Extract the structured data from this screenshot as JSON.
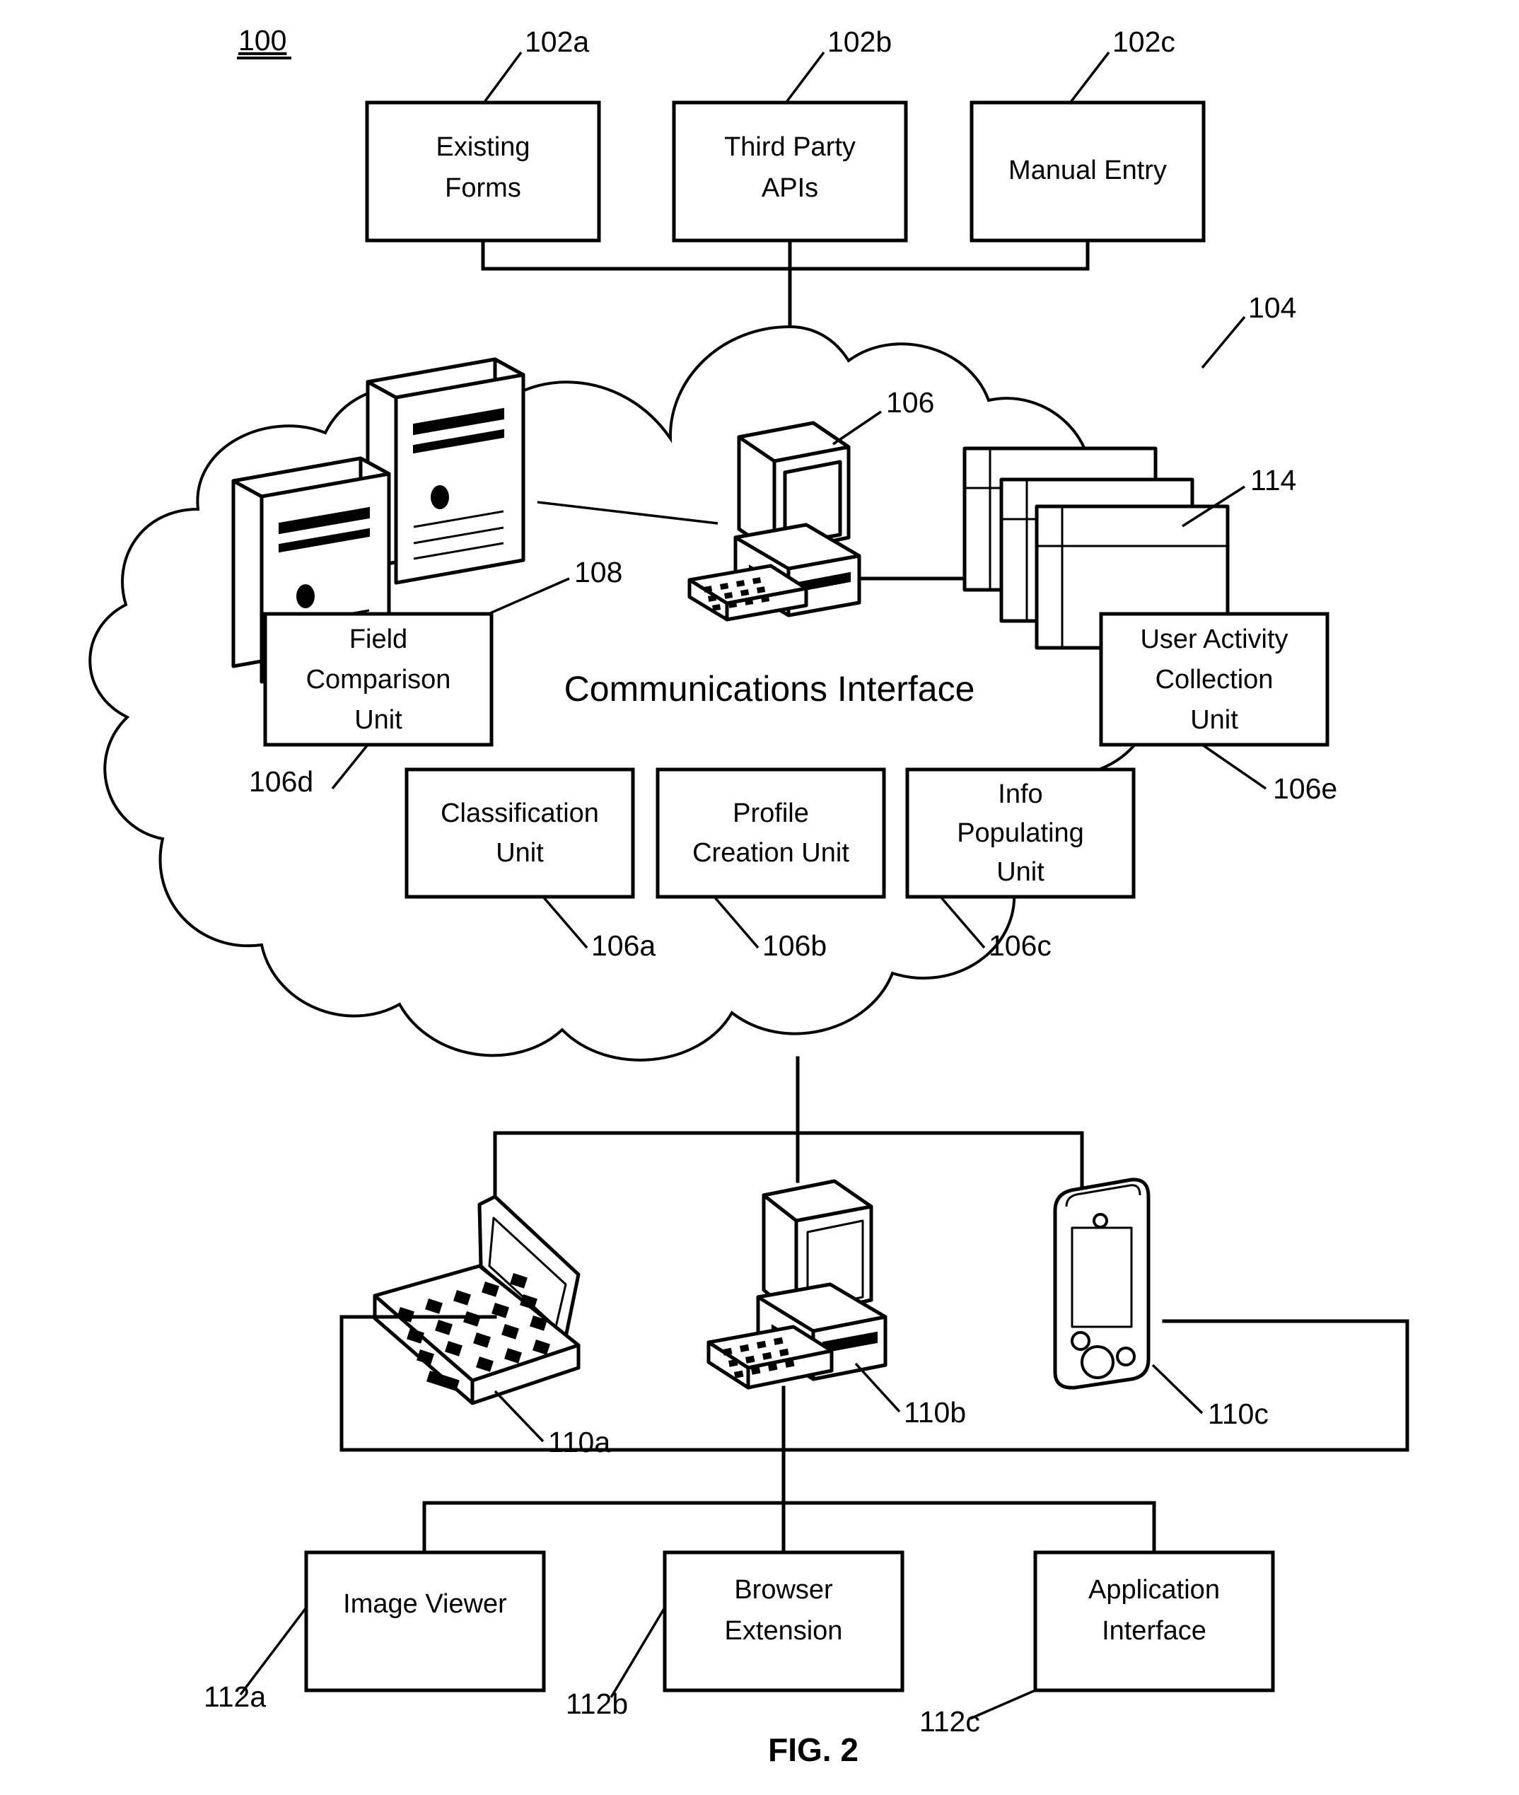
{
  "figure": {
    "caption": "FIG. 2",
    "system_number": "100"
  },
  "sources": {
    "boxes": [
      {
        "label_line1": "Existing",
        "label_line2": "Forms",
        "ref": "102a"
      },
      {
        "label_line1": "Third Party",
        "label_line2": "APIs",
        "ref": "102b"
      },
      {
        "label_line1": "Manual Entry",
        "label_line2": "",
        "ref": "102c"
      }
    ]
  },
  "cloud": {
    "ref": "104",
    "title": "Communications Interface",
    "icons": [
      {
        "name": "server-stack-icon",
        "ref": "108"
      },
      {
        "name": "desktop-computer-icon",
        "ref": "106"
      },
      {
        "name": "documents-stack-icon",
        "ref": "114"
      }
    ],
    "units": [
      {
        "label_line1": "Field",
        "label_line2": "Comparison",
        "label_line3": "Unit",
        "ref": "106d"
      },
      {
        "label_line1": "User Activity",
        "label_line2": "Collection",
        "label_line3": "Unit",
        "ref": "106e"
      },
      {
        "label_line1": "Classification",
        "label_line2": "Unit",
        "label_line3": "",
        "ref": "106a"
      },
      {
        "label_line1": "Profile",
        "label_line2": "Creation Unit",
        "label_line3": "",
        "ref": "106b"
      },
      {
        "label_line1": "Info",
        "label_line2": "Populating",
        "label_line3": "Unit",
        "ref": "106c"
      }
    ]
  },
  "clients": {
    "devices": [
      {
        "name": "laptop-icon",
        "ref": "110a"
      },
      {
        "name": "desktop-computer-icon",
        "ref": "110b"
      },
      {
        "name": "pda-handheld-icon",
        "ref": "110c"
      }
    ]
  },
  "applications": {
    "boxes": [
      {
        "label_line1": "Image Viewer",
        "label_line2": "",
        "ref": "112a"
      },
      {
        "label_line1": "Browser",
        "label_line2": "Extension",
        "ref": "112b"
      },
      {
        "label_line1": "Application",
        "label_line2": "Interface",
        "ref": "112c"
      }
    ]
  },
  "colors": {
    "ink": "#000000",
    "paper": "#ffffff"
  }
}
